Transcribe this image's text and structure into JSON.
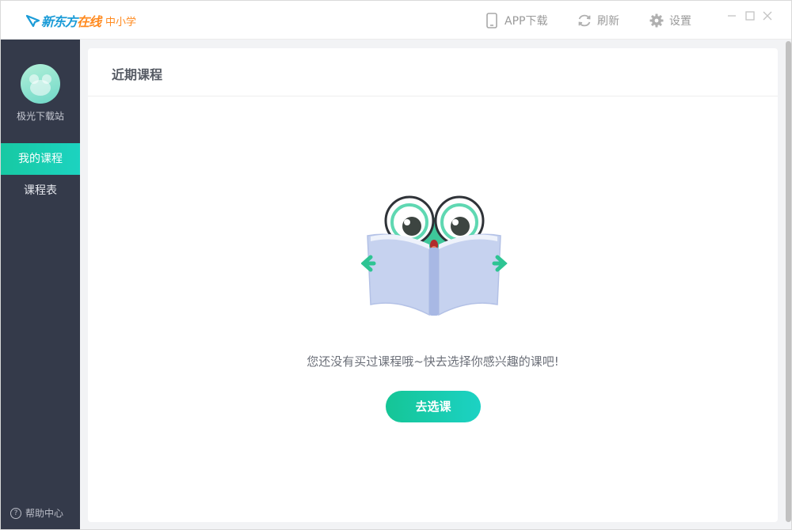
{
  "titlebar": {
    "brand": {
      "part1": "新东方",
      "part2": "在线",
      "sub": "中小学"
    },
    "app_download": "APP下载",
    "refresh": "刷新",
    "settings": "设置"
  },
  "sidebar": {
    "username": "极光下载站",
    "items": [
      {
        "label": "我的课程",
        "active": true
      },
      {
        "label": "课程表",
        "active": false
      }
    ],
    "help": "帮助中心"
  },
  "main": {
    "section_title": "近期课程",
    "empty_message": "您还没有买过课程哦~快去选择你感兴趣的课吧!",
    "cta_label": "去选课"
  },
  "colors": {
    "accent": "#17c9a3",
    "sidebar_bg": "#343a4a",
    "brand_blue": "#1a9bd7",
    "brand_orange": "#ff8a1f"
  }
}
